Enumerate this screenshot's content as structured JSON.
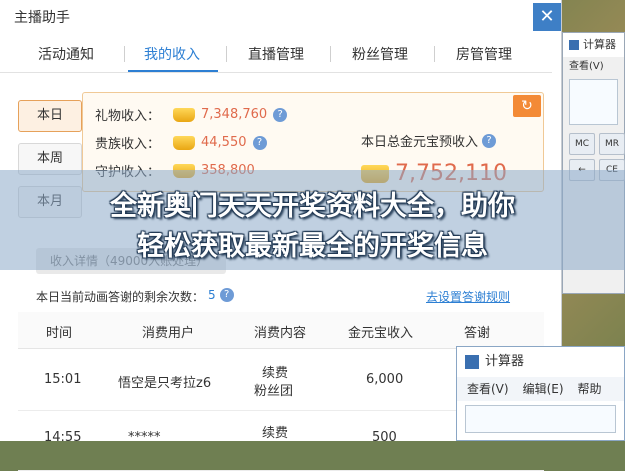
{
  "window": {
    "title": "主播助手"
  },
  "tabs": [
    {
      "label": "活动通知"
    },
    {
      "label": "我的收入"
    },
    {
      "label": "直播管理"
    },
    {
      "label": "粉丝管理"
    },
    {
      "label": "房管管理"
    }
  ],
  "day_buttons": [
    {
      "label": "本日"
    },
    {
      "label": "本周"
    },
    {
      "label": "本月"
    }
  ],
  "income": {
    "gift_label": "礼物收入：",
    "gift_value": "7,348,760",
    "noble_label": "贵族收入：",
    "noble_value": "44,550",
    "guard_label": "守护收入：",
    "guard_value": "358,800",
    "total_label": "本日总金元宝预收入",
    "total_value": "7,752,110"
  },
  "income_detail_button": "收入详情（49000入账处理）",
  "remain": {
    "label": "本日当前动画答谢的剩余次数：",
    "count": "5"
  },
  "set_rule_link": "去设置答谢规则",
  "table": {
    "headers": [
      "时间",
      "消费用户",
      "消费内容",
      "金元宝收入",
      "答谢"
    ],
    "rows": [
      {
        "time": "15:01",
        "user": "悟空是只考拉z6",
        "content_line1": "续费",
        "content_line2": "粉丝团",
        "amount": "6,000"
      },
      {
        "time": "14:55",
        "user": "*****",
        "content_line1": "续费",
        "content_line2": "",
        "amount": "500"
      }
    ]
  },
  "banner": {
    "line1": "全新奥门天天开奖资料大全，助你",
    "line2": "轻松获取最新最全的开奖信息"
  },
  "calc_back": {
    "title": "计算器",
    "menu": "查看(V)"
  },
  "calc_front": {
    "title": "计算器",
    "menu": [
      "查看(V)",
      "编辑(E)",
      "帮助"
    ]
  },
  "colors": {
    "accent": "#2d7fd3",
    "value": "#e06a4c",
    "orange": "#f38a36"
  }
}
